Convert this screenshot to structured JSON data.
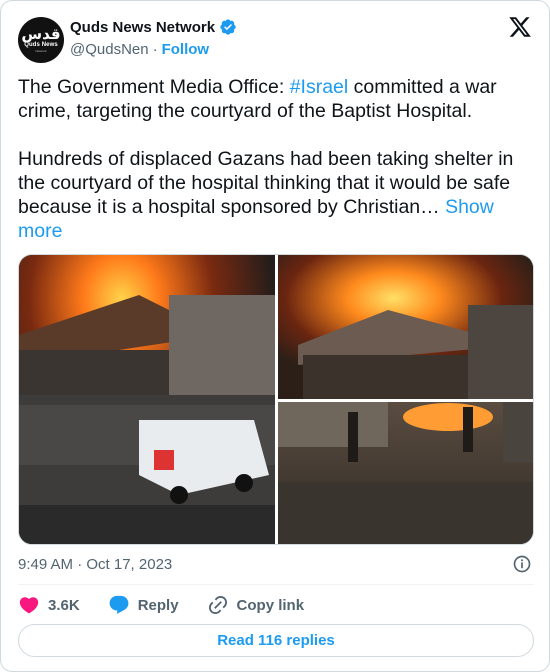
{
  "author": {
    "name": "Quds News Network",
    "handle": "@QudsNen",
    "separator": "·",
    "follow_label": "Follow",
    "avatar_glyph": "قدس",
    "avatar_mark": "Quds News",
    "avatar_sub": "Network"
  },
  "tweet": {
    "line1_prefix": "The Government Media Office: ",
    "hashtag": "#Israel",
    "line1_suffix": " committed a war crime, targeting the courtyard of the Baptist Hospital.\n\nHundreds of displaced Gazans had been taking shelter in the courtyard of the hospital thinking that it would be safe because it is a hospital sponsored by Christian… ",
    "show_more": "Show more"
  },
  "footer": {
    "timestamp": "9:49 AM · Oct 17, 2023",
    "likes": "3.6K",
    "reply_label": "Reply",
    "copy_link_label": "Copy link",
    "read_replies": "Read 116 replies"
  },
  "colors": {
    "accent": "#1d9bf0",
    "like": "#f91880",
    "muted": "#536471",
    "text": "#0f1419"
  },
  "icons": {
    "verified": "verified-badge-icon",
    "x_logo": "x-logo-icon",
    "info": "info-icon",
    "heart": "heart-icon",
    "reply": "reply-bubble-icon",
    "link": "link-icon"
  }
}
